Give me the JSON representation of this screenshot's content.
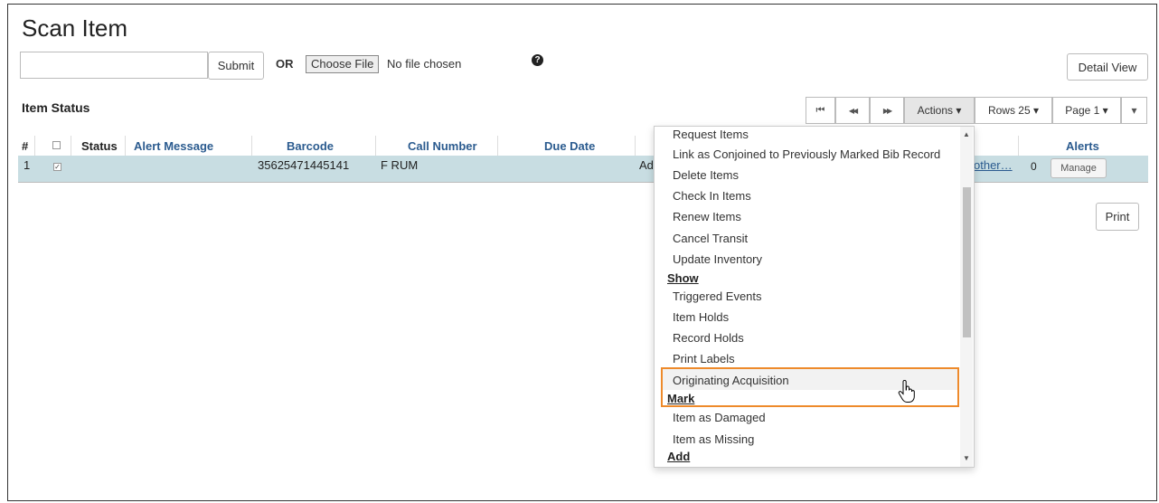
{
  "page": {
    "title": "Scan Item",
    "submit_label": "Submit",
    "or_label": "OR",
    "choose_file_label": "Choose File",
    "no_file_label": "No file chosen",
    "help_glyph": "?",
    "detail_view_label": "Detail View",
    "item_status_label": "Item Status",
    "print_label": "Print"
  },
  "pager": {
    "first_glyph": "⏮",
    "prev_glyph": "◀◀",
    "next_glyph": "▶▶",
    "actions_label": "Actions ▾",
    "rows_label": "Rows 25 ▾",
    "page_label": "Page 1 ▾",
    "more_glyph": "▾"
  },
  "table": {
    "columns": {
      "num": "#",
      "status": "Status",
      "alert_message": "Alert Message",
      "barcode": "Barcode",
      "call_number": "Call Number",
      "due_date": "Due Date",
      "alerts": "Alerts"
    },
    "row": {
      "num": "1",
      "barcode": "35625471445141",
      "call_number": "F RUM",
      "truncated_col": "Ad",
      "other_link": "other…",
      "alert_count": "0",
      "manage_label": "Manage"
    }
  },
  "menu": {
    "items_top": [
      "Request Items",
      "Link as Conjoined to Previously Marked Bib Record",
      "Delete Items",
      "Check In Items",
      "Renew Items",
      "Cancel Transit",
      "Update Inventory"
    ],
    "show_header": "Show",
    "show_items": [
      "Triggered Events",
      "Item Holds",
      "Record Holds",
      "Print Labels",
      "Originating Acquisition"
    ],
    "mark_header": "Mark",
    "mark_items": [
      "Item as Damaged",
      "Item as Missing"
    ],
    "add_header": "Add"
  },
  "colors": {
    "highlight_border": "#ee8a2b",
    "row_selected": "#c8dde2",
    "header_link": "#2b5b8f"
  }
}
